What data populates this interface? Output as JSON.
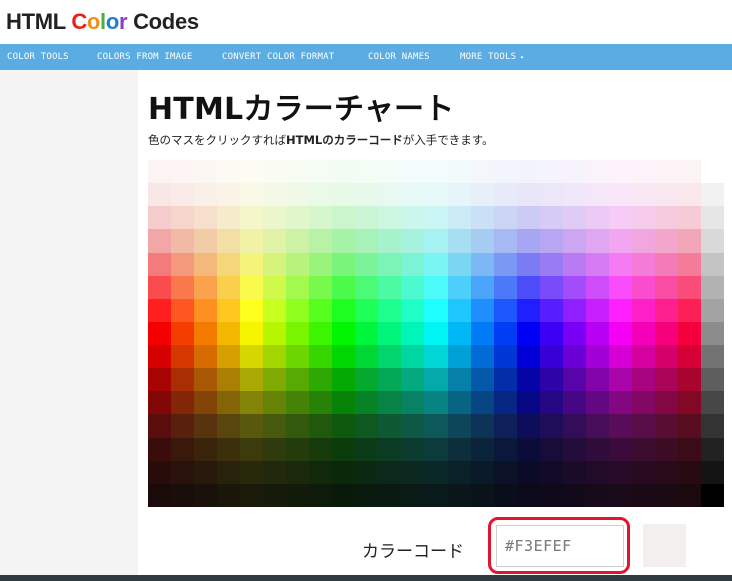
{
  "header": {
    "logo_word1": "HTML",
    "logo_word2": "Color",
    "logo_word2_colors": [
      "#e8221b",
      "#f09019",
      "#4caf3b",
      "#1e7fd6",
      "#8a3fc1"
    ],
    "logo_word3": "Codes"
  },
  "nav": {
    "items": [
      {
        "label": "COLOR TOOLS"
      },
      {
        "label": "COLORS FROM IMAGE"
      },
      {
        "label": "CONVERT COLOR FORMAT"
      },
      {
        "label": "COLOR NAMES"
      },
      {
        "label": "MORE TOOLS",
        "icon": "chevron-right-icon"
      }
    ]
  },
  "main": {
    "title": "HTMLカラーチャート",
    "intro_part1": "色のマスをクリックすれば",
    "intro_bold": "HTMLのカラーコード",
    "intro_part2": "が入手できます。"
  },
  "picker": {
    "label": "カラーコード",
    "value": "#F3EFEF",
    "preview_color": "#F3EFEF",
    "highlight_color": "#e5142e"
  },
  "palette": {
    "hue_steps": 24,
    "rows": [
      {
        "s": 60,
        "l": 97
      },
      {
        "s": 60,
        "l": 94
      },
      {
        "s": 70,
        "l": 88
      },
      {
        "s": 75,
        "l": 80
      },
      {
        "s": 85,
        "l": 72
      },
      {
        "s": 95,
        "l": 64
      },
      {
        "s": 100,
        "l": 56
      },
      {
        "s": 100,
        "l": 48
      },
      {
        "s": 100,
        "l": 42
      },
      {
        "s": 95,
        "l": 34
      },
      {
        "s": 90,
        "l": 27
      },
      {
        "s": 75,
        "l": 20
      },
      {
        "s": 65,
        "l": 14
      },
      {
        "s": 55,
        "l": 10
      },
      {
        "s": 45,
        "l": 7
      }
    ],
    "grays": [
      "#ffffff",
      "#f2f2f2",
      "#e6e6e6",
      "#d9d9d9",
      "#c4c4c4",
      "#b2b2b2",
      "#a3a3a3",
      "#8c8c8c",
      "#737373",
      "#5e5e5e",
      "#474747",
      "#333333",
      "#222222",
      "#141414",
      "#000000"
    ]
  }
}
